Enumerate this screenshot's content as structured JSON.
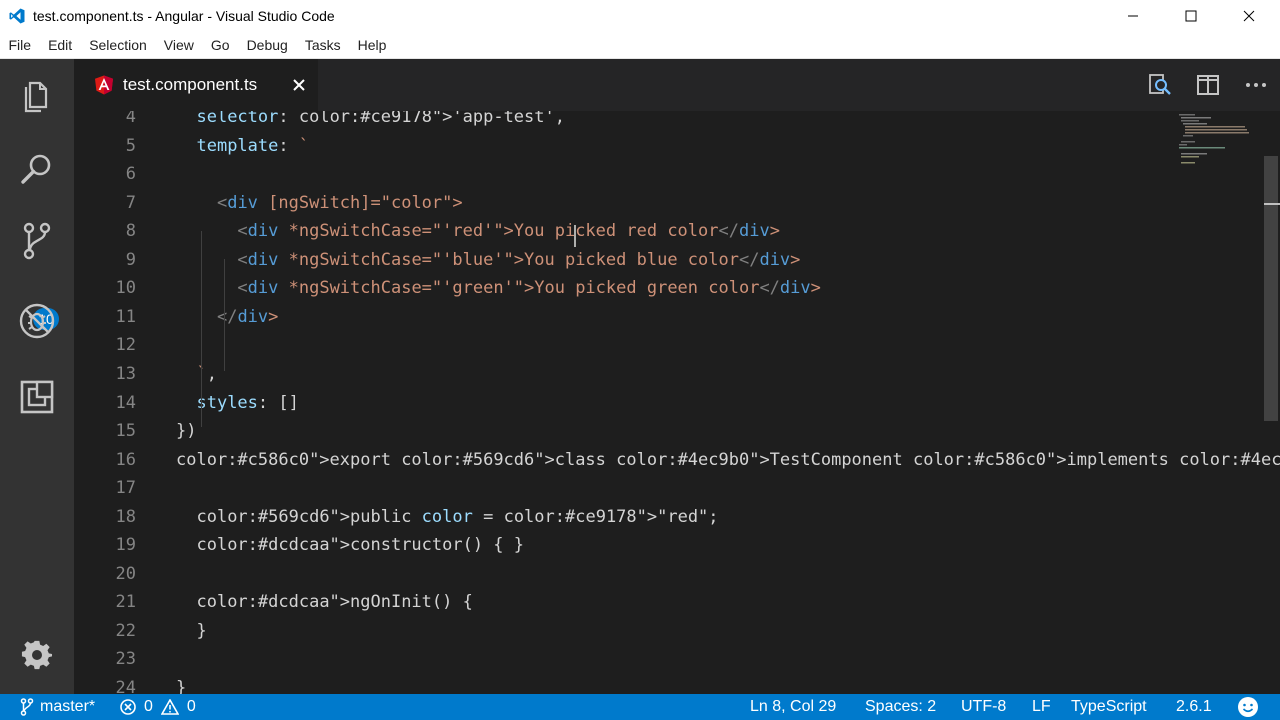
{
  "window": {
    "title": "test.component.ts - Angular - Visual Studio Code"
  },
  "menu": [
    "File",
    "Edit",
    "Selection",
    "View",
    "Go",
    "Debug",
    "Tasks",
    "Help"
  ],
  "activity": {
    "scm_badge": "10"
  },
  "tab": {
    "label": "test.component.ts"
  },
  "editor": {
    "lines": [
      {
        "n": "4",
        "code": "  selector: 'app-test',"
      },
      {
        "n": "5",
        "code": "  template: `"
      },
      {
        "n": "6",
        "code": ""
      },
      {
        "n": "7",
        "code": "    <div [ngSwitch]=\"color\">"
      },
      {
        "n": "8",
        "code": "      <div *ngSwitchCase=\"'red'\">You picked red color</div>"
      },
      {
        "n": "9",
        "code": "      <div *ngSwitchCase=\"'blue'\">You picked blue color</div>"
      },
      {
        "n": "10",
        "code": "      <div *ngSwitchCase=\"'green'\">You picked green color</div>"
      },
      {
        "n": "11",
        "code": "    </div>"
      },
      {
        "n": "12",
        "code": ""
      },
      {
        "n": "13",
        "code": "  `,"
      },
      {
        "n": "14",
        "code": "  styles: []"
      },
      {
        "n": "15",
        "code": "})"
      },
      {
        "n": "16",
        "code": "export class TestComponent implements OnInit {"
      },
      {
        "n": "17",
        "code": ""
      },
      {
        "n": "18",
        "code": "  public color = \"red\";"
      },
      {
        "n": "19",
        "code": "  constructor() { }"
      },
      {
        "n": "20",
        "code": ""
      },
      {
        "n": "21",
        "code": "  ngOnInit() {"
      },
      {
        "n": "22",
        "code": "  }"
      },
      {
        "n": "23",
        "code": ""
      },
      {
        "n": "24",
        "code": "}"
      }
    ]
  },
  "status": {
    "branch": "master*",
    "errors": "0",
    "warnings": "0",
    "position": "Ln 8, Col 29",
    "spaces": "Spaces: 2",
    "encoding": "UTF-8",
    "eol": "LF",
    "language": "TypeScript",
    "version": "2.6.1"
  },
  "colors": {
    "accent": "#007acc",
    "editor_bg": "#1e1e1e",
    "keyword": "#c586c0",
    "storage": "#569cd6",
    "class": "#4ec9b0",
    "function": "#dcdcaa",
    "property": "#9cdcfe",
    "string": "#ce9178",
    "tag": "#808080"
  }
}
